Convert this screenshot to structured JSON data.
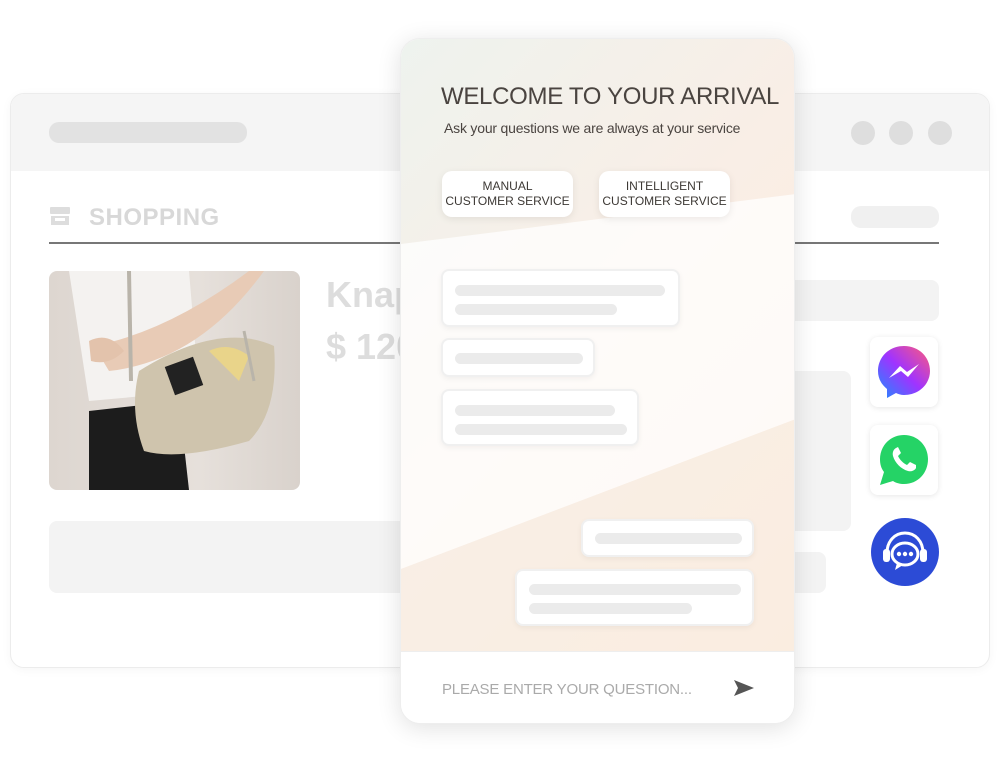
{
  "shop": {
    "section_title": "SHOPPING",
    "product_name": "Knap",
    "product_price": "$ 120"
  },
  "chat": {
    "title": "WELCOME TO YOUR ARRIVAL",
    "subtitle": "Ask your questions we are always at your service",
    "buttons": [
      {
        "line1": "MANUAL",
        "line2": "CUSTOMER SERVICE"
      },
      {
        "line1": "INTELLIGENT",
        "line2": "CUSTOMER SERVICE"
      }
    ],
    "input_placeholder": "PLEASE ENTER YOUR QUESTION...",
    "send_icon": "send-icon"
  },
  "channels": [
    {
      "name": "messenger",
      "icon": "messenger-icon",
      "color": "#a033ff"
    },
    {
      "name": "whatsapp",
      "icon": "whatsapp-icon",
      "color": "#25d366"
    },
    {
      "name": "live-support",
      "icon": "headset-chat-icon",
      "color": "#2c4bd6"
    }
  ]
}
